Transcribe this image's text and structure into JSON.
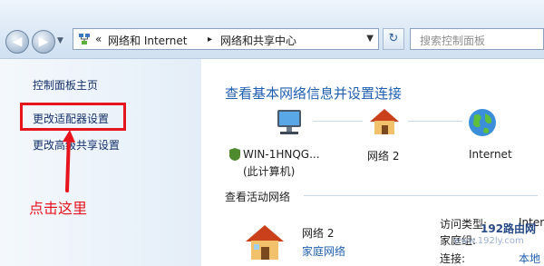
{
  "toolbar": {
    "breadcrumb": [
      "网络和 Internet",
      "网络和共享中心"
    ],
    "breadcrumb_lead": "«",
    "separator": "▸",
    "search_placeholder": "搜索控制面板"
  },
  "sidebar": {
    "items": [
      {
        "label": "控制面板主页"
      },
      {
        "label": "更改适配器设置"
      },
      {
        "label": "更改高级共享设置"
      }
    ]
  },
  "annotation": {
    "callout": "点击这里",
    "highlight_color": "#e8141d"
  },
  "main": {
    "title": "查看基本网络信息并设置连接",
    "map": {
      "computer_name": "WIN-1HNQG...",
      "computer_sub": "(此计算机)",
      "network": "网络  2",
      "internet": "Internet"
    },
    "active_networks_title": "查看活动网络",
    "network": {
      "name": "网络  2",
      "type_link": "家庭网络",
      "access_type_label": "访问类型:",
      "access_type_value": "Inter",
      "homegroup_label": "家庭组:",
      "connections_label": "连接:",
      "connections_value": "本地"
    }
  },
  "watermark": {
    "brand": "192路由网",
    "url": "www.192ly.com"
  },
  "colors": {
    "link": "#1f5fb0",
    "sidebar_link": "#15306a",
    "accent_red": "#e8141d"
  }
}
